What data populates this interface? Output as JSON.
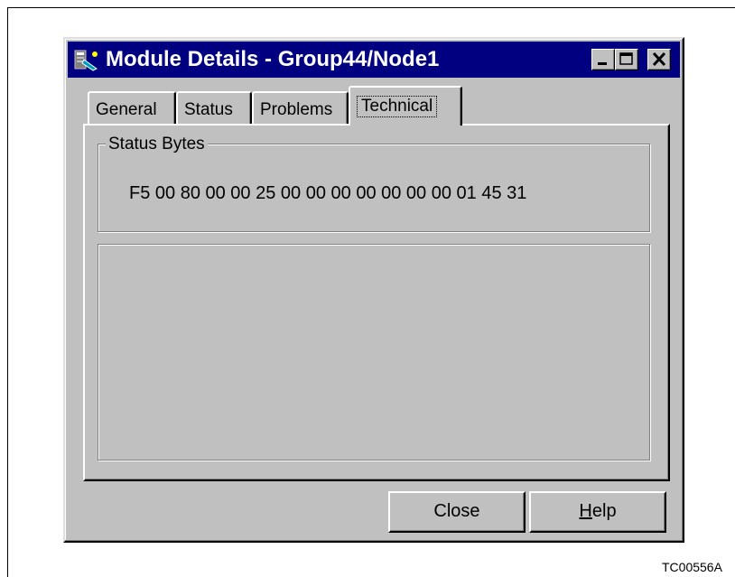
{
  "window": {
    "title": "Module Details - Group44/Node1",
    "controls": {
      "minimize_icon": "minimize-icon",
      "maximize_icon": "maximize-icon",
      "close_icon": "close-icon"
    }
  },
  "tabs": [
    {
      "label": "General",
      "active": false
    },
    {
      "label": "Status",
      "active": false
    },
    {
      "label": "Problems",
      "active": false
    },
    {
      "label": "Technical",
      "active": true
    }
  ],
  "status_bytes": {
    "label": "Status Bytes",
    "value": "F5 00 80 00 00 25 00 00 00 00 00 00 00 01 45 31"
  },
  "buttons": {
    "close_label": "Close",
    "help_label_mnemonic": "H",
    "help_label_rest": "elp"
  },
  "figure_label": "TC00556A",
  "colors": {
    "titlebar": "#000080",
    "face": "#c0c0c0",
    "shadow": "#808080",
    "highlight": "#ffffff"
  }
}
